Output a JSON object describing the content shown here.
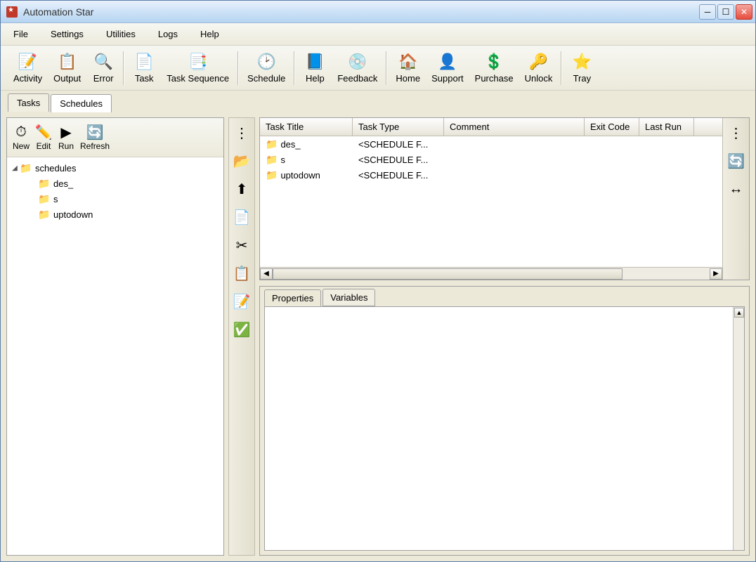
{
  "window": {
    "title": "Automation Star"
  },
  "menubar": [
    "File",
    "Settings",
    "Utilities",
    "Logs",
    "Help"
  ],
  "toolbar": [
    {
      "id": "activity",
      "label": "Activity",
      "icon": "📝"
    },
    {
      "id": "output",
      "label": "Output",
      "icon": "📋"
    },
    {
      "id": "error",
      "label": "Error",
      "icon": "🔍"
    },
    {
      "sep": true
    },
    {
      "id": "task",
      "label": "Task",
      "icon": "📄"
    },
    {
      "id": "tasksequence",
      "label": "Task Sequence",
      "icon": "📑"
    },
    {
      "sep": true
    },
    {
      "id": "schedule",
      "label": "Schedule",
      "icon": "🕑"
    },
    {
      "sep": true
    },
    {
      "id": "help",
      "label": "Help",
      "icon": "📘"
    },
    {
      "id": "feedback",
      "label": "Feedback",
      "icon": "💿"
    },
    {
      "sep": true
    },
    {
      "id": "home",
      "label": "Home",
      "icon": "🏠"
    },
    {
      "id": "support",
      "label": "Support",
      "icon": "👤"
    },
    {
      "id": "purchase",
      "label": "Purchase",
      "icon": "💲"
    },
    {
      "id": "unlock",
      "label": "Unlock",
      "icon": "🔑"
    },
    {
      "sep": true
    },
    {
      "id": "tray",
      "label": "Tray",
      "icon": "⭐"
    }
  ],
  "tabs": [
    {
      "label": "Tasks",
      "active": false
    },
    {
      "label": "Schedules",
      "active": true
    }
  ],
  "left_toolbar": [
    {
      "id": "new",
      "label": "New",
      "icon": "⏱"
    },
    {
      "id": "edit",
      "label": "Edit",
      "icon": "✏️"
    },
    {
      "id": "run",
      "label": "Run",
      "icon": "▶"
    },
    {
      "id": "refresh",
      "label": "Refresh",
      "icon": "🔄"
    }
  ],
  "tree": {
    "root": {
      "label": "schedules",
      "expanded": true
    },
    "children": [
      {
        "label": "des_"
      },
      {
        "label": "s"
      },
      {
        "label": "uptodown"
      }
    ]
  },
  "mid_toolbar_icons": [
    {
      "id": "grip",
      "icon": "⋮"
    },
    {
      "id": "folder",
      "icon": "📂"
    },
    {
      "id": "up",
      "icon": "⬆"
    },
    {
      "id": "copy",
      "icon": "📄"
    },
    {
      "id": "cut",
      "icon": "✂"
    },
    {
      "id": "paste",
      "icon": "📋"
    },
    {
      "id": "note",
      "icon": "📝"
    },
    {
      "id": "check",
      "icon": "✅"
    }
  ],
  "right_side_icons": [
    {
      "id": "grip2",
      "icon": "⋮"
    },
    {
      "id": "refresh2",
      "icon": "🔄"
    },
    {
      "id": "expand",
      "icon": "↔"
    }
  ],
  "table": {
    "columns": [
      {
        "key": "title",
        "label": "Task Title"
      },
      {
        "key": "type",
        "label": "Task Type"
      },
      {
        "key": "comment",
        "label": "Comment"
      },
      {
        "key": "exit",
        "label": "Exit Code"
      },
      {
        "key": "last",
        "label": "Last Run"
      }
    ],
    "rows": [
      {
        "title": "des_",
        "type": "<SCHEDULE F...",
        "comment": "",
        "exit": "",
        "last": ""
      },
      {
        "title": "s",
        "type": "<SCHEDULE F...",
        "comment": "",
        "exit": "",
        "last": ""
      },
      {
        "title": "uptodown",
        "type": "<SCHEDULE F...",
        "comment": "",
        "exit": "",
        "last": ""
      }
    ]
  },
  "bottom_tabs": [
    {
      "label": "Properties",
      "active": true
    },
    {
      "label": "Variables",
      "active": false
    }
  ]
}
